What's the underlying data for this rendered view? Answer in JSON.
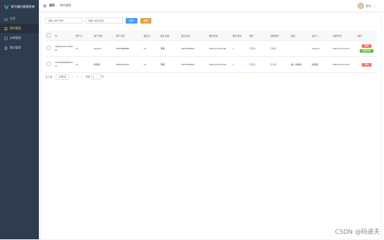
{
  "brand": {
    "title": "接号确约管理系统"
  },
  "sidebar": {
    "items": [
      {
        "label": "主页",
        "icon": "home-icon",
        "active": false
      },
      {
        "label": "预约管理",
        "icon": "grid-icon",
        "active": true
      },
      {
        "label": "诊断管理",
        "icon": "stethoscope-icon",
        "active": false
      },
      {
        "label": "就诊管理",
        "icon": "clipboard-icon",
        "active": false
      }
    ]
  },
  "topbar": {
    "breadcrumb": [
      "首页",
      "预约管理"
    ],
    "user": {
      "name": "张伦"
    }
  },
  "filters": {
    "input1_placeholder": "请输入用户名称",
    "input2_placeholder": "请输入医生名称",
    "search_label": "查询",
    "reset_label": "重置"
  },
  "table": {
    "headers": [
      "ID",
      "用户ID",
      "用户名称",
      "用户手机",
      "医生ID",
      "医生名称",
      "医生手机",
      "预约时间",
      "医生号码",
      "预约",
      "诊断预约",
      "留言",
      "治疗人",
      "诊断时间",
      "操作"
    ],
    "rows": [
      {
        "id": "18663219137250961",
        "uid": "11",
        "uname": "pascual",
        "uphone": "18878888888",
        "did": "12",
        "dname": "李医",
        "dphone": "18876789606",
        "time": "2024-11-19 09:58",
        "num": "1",
        "status": "已预约",
        "diag": "已确诊",
        "note": "",
        "handler": "pascual",
        "dtime": "2024-11-09 23:14",
        "ops": [
          "删除",
          "查看诊断"
        ]
      },
      {
        "id": "17809990988951327",
        "uid": "11",
        "uname": "秋晓建",
        "uphone": "18811221546",
        "did": "12",
        "dname": "李医",
        "dphone": "18876789606",
        "time": "2024-12-05 10:09",
        "num": "1",
        "status": "待就诊",
        "diag": "待诊断",
        "note": "第一次确诊",
        "handler": "秋晓建",
        "dtime": "2024-12-05 14:51",
        "ops": [
          "删除"
        ]
      }
    ]
  },
  "pager": {
    "total": "共 2 条",
    "page_size": "10条/页",
    "prev": "‹",
    "current": "1",
    "next": "›",
    "goto_label": "前往",
    "goto_value": "1",
    "page_unit": "页"
  },
  "watermark": "CSDN @码递夫",
  "colors": {
    "sidebar_bg": "#2f3c4f",
    "accent": "#409eff",
    "warning": "#e6a23c",
    "danger": "#f56c6c",
    "success": "#67c23a"
  }
}
